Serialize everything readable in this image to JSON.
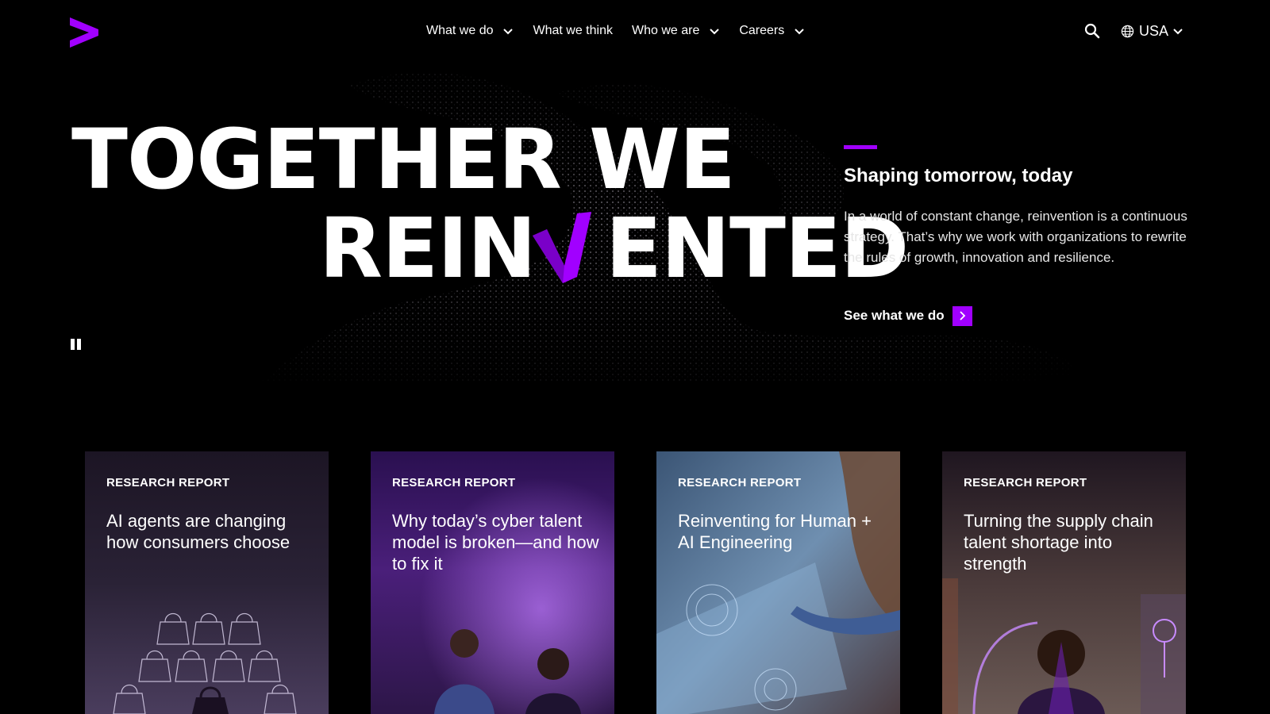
{
  "header": {
    "nav": [
      {
        "label": "What we do",
        "has_dropdown": true
      },
      {
        "label": "What we think",
        "has_dropdown": false
      },
      {
        "label": "Who we are",
        "has_dropdown": true
      },
      {
        "label": "Careers",
        "has_dropdown": true
      }
    ],
    "locale": "USA",
    "icons": {
      "logo": "accenture-greater-than-logo",
      "search": "search-icon",
      "locale": "globe-icon"
    }
  },
  "hero": {
    "headline_line1": "TOGETHER WE",
    "headline_line2_left": "REIN",
    "headline_line2_right": "ENTED",
    "subtitle": "Shaping tomorrow, today",
    "body": "In a world of constant change, reinvention is a continuous strategy. That’s why we work with organizations to rewrite the rules of growth, innovation and resilience.",
    "cta_label": "See what we do"
  },
  "cards": [
    {
      "label": "RESEARCH REPORT",
      "title": "AI agents are changing how consumers choose"
    },
    {
      "label": "RESEARCH REPORT",
      "title": "Why today’s cyber talent model is broken—and how to fix it"
    },
    {
      "label": "RESEARCH REPORT",
      "title": "Reinventing for Human + AI Engineering"
    },
    {
      "label": "RESEARCH REPORT",
      "title": "Turning the supply chain talent shortage into strength"
    }
  ],
  "colors": {
    "background": "#000000",
    "accent": "#a100ff",
    "text": "#ffffff"
  }
}
